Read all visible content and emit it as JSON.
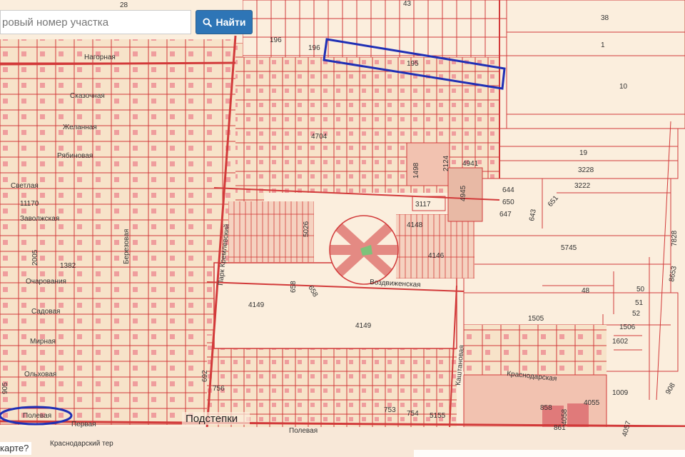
{
  "search": {
    "placeholder": "ровый номер участка",
    "button_label": "Найти",
    "button_icon": "search-icon"
  },
  "colors": {
    "map_background": "#fbeedd",
    "parcel_stroke": "#d23a3a",
    "parcel_fill": "#f7e2c8",
    "building_fill": "#ef9d9d",
    "highlight": "#1f2fb5",
    "button_bg": "#2e75b6"
  },
  "bottom_hint": "карте?",
  "map": {
    "streets": [
      "Нагорная",
      "Сказочная",
      "Желанная",
      "Рябиновая",
      "Светлая",
      "Заволжская",
      "Очарования",
      "Садовая",
      "Мирная",
      "Ольховая",
      "Полевая",
      "Воздвиженская",
      "Краснодарская",
      "Березовая",
      "Парк Кремлевский",
      "Полевая",
      "Каштановая",
      "Краснодарский тер",
      "Первая"
    ],
    "parcel_labels": [
      "28",
      "43",
      "38",
      "1",
      "196",
      "196",
      "195",
      "10",
      "4704",
      "1498",
      "2124",
      "4941",
      "19",
      "3228",
      "3222",
      "4945",
      "644",
      "650",
      "647",
      "651",
      "643",
      "3117",
      "4148",
      "4146",
      "5026",
      "11170",
      "2005",
      "1382",
      "5745",
      "658",
      "658",
      "48",
      "50",
      "51",
      "52",
      "4149",
      "4149",
      "1505",
      "1506",
      "1602",
      "7828",
      "8653",
      "692",
      "756",
      "1009",
      "905",
      "753",
      "754",
      "5155",
      "858",
      "4055",
      "4058",
      "861",
      "4057",
      "908"
    ],
    "place_label": "Подстепки",
    "highlighted_parcel": "195",
    "highlighted_street": "Полевая"
  }
}
